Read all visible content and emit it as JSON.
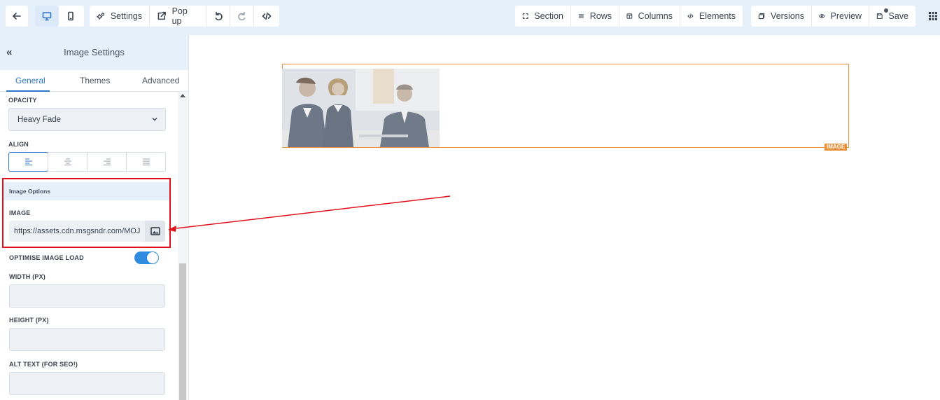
{
  "toolbar": {
    "settings_label": "Settings",
    "popup_label": "Pop up",
    "section_label": "Section",
    "rows_label": "Rows",
    "columns_label": "Columns",
    "elements_label": "Elements",
    "versions_label": "Versions",
    "preview_label": "Preview",
    "save_label": "Save",
    "icons": [
      "back-arrow-icon",
      "desktop-icon",
      "mobile-icon",
      "gears-icon",
      "external-link-icon",
      "undo-icon",
      "redo-icon",
      "code-icon",
      "expand-icon",
      "list-icon",
      "columns-icon",
      "code-icon",
      "versions-icon",
      "eye-icon",
      "save-icon",
      "grid-icon"
    ]
  },
  "sidebar": {
    "title": "Image Settings",
    "tabs": [
      {
        "label": "General",
        "active": true
      },
      {
        "label": "Themes",
        "active": false
      },
      {
        "label": "Advanced",
        "active": false
      }
    ],
    "opacity_label": "OPACITY",
    "opacity_value": "Heavy Fade",
    "align_label": "ALIGN",
    "align_options": [
      "left",
      "center",
      "right",
      "justify"
    ],
    "align_selected": "left",
    "section_title": "Image Options",
    "image_label": "IMAGE",
    "image_url": "https://assets.cdn.msgsndr.com/MOJ",
    "optimise_label": "OPTIMISE IMAGE LOAD",
    "optimise_on": true,
    "width_label": "WIDTH (PX)",
    "width_value": "",
    "height_label": "HEIGHT (PX)",
    "height_value": "",
    "alt_label": "ALT TEXT (FOR SEO!)",
    "alt_value": ""
  },
  "canvas": {
    "element_tag": "IMAGE"
  },
  "colors": {
    "accent": "#2f77c9",
    "toolbar_bg": "#e6f0fb",
    "element_outline": "#e8913a",
    "annotation": "#e0101a",
    "toggle_on": "#2f8ce0"
  }
}
